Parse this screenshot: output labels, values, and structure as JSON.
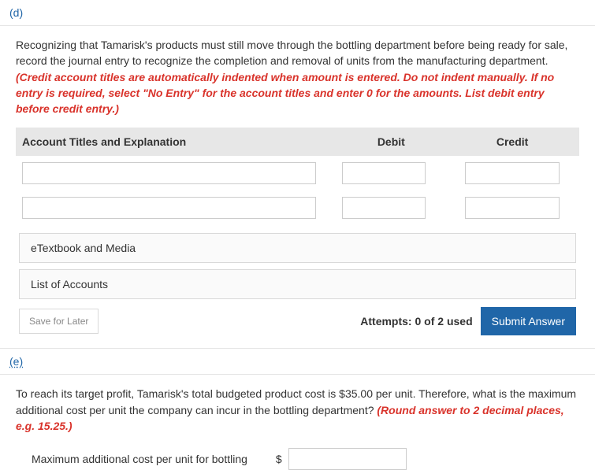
{
  "section_d": {
    "label": "(d)",
    "instructions_plain": "Recognizing that Tamarisk's products must still move through the bottling department before being ready for sale, record the journal entry to recognize the completion and removal of units from the manufacturing department. ",
    "instructions_warn": "(Credit account titles are automatically indented when amount is entered. Do not indent manually. If no entry is required, select \"No Entry\" for the account titles and enter 0 for the amounts. List debit entry before credit entry.)",
    "table": {
      "headers": {
        "account": "Account Titles and Explanation",
        "debit": "Debit",
        "credit": "Credit"
      },
      "rows": [
        {
          "account": "",
          "debit": "",
          "credit": ""
        },
        {
          "account": "",
          "debit": "",
          "credit": ""
        }
      ]
    },
    "etextbook": "eTextbook and Media",
    "list_accounts": "List of Accounts",
    "save_later": "Save for Later",
    "attempts": "Attempts: 0 of 2 used",
    "submit": "Submit Answer"
  },
  "section_e": {
    "label": "(e)",
    "instructions_plain": "To reach its target profit, Tamarisk's total budgeted product cost is $35.00 per unit. Therefore, what is the maximum additional cost per unit the company can incur in the bottling department? ",
    "instructions_warn": "(Round answer to 2 decimal places, e.g. 15.25.)",
    "answer_label": "Maximum additional cost per unit for bottling",
    "currency": "$",
    "answer_value": ""
  }
}
